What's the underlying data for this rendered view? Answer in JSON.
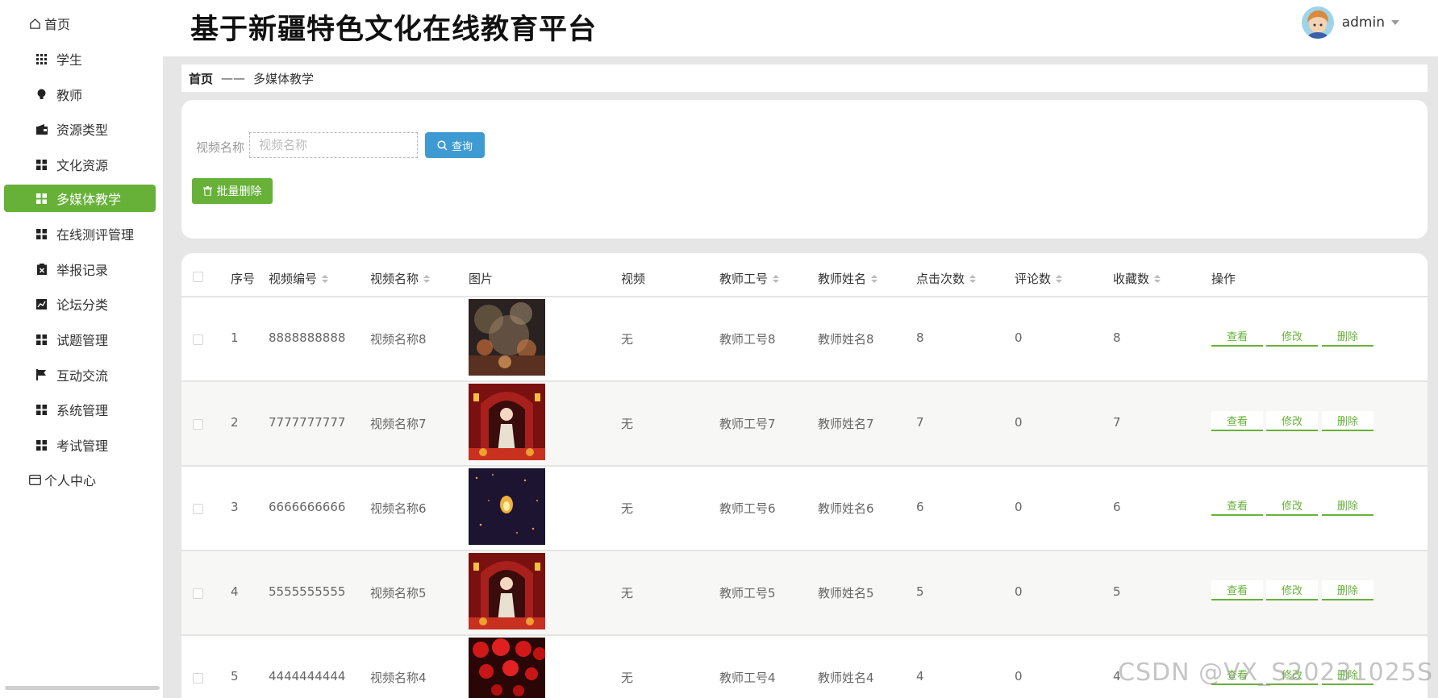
{
  "app": {
    "title": "基于新疆特色文化在线教育平台"
  },
  "user": {
    "name": "admin"
  },
  "sidebar": {
    "items": [
      {
        "label": "首页",
        "icon": "home-icon"
      },
      {
        "label": "学生",
        "icon": "grid-icon"
      },
      {
        "label": "教师",
        "icon": "bulb-icon"
      },
      {
        "label": "资源类型",
        "icon": "wallet-icon"
      },
      {
        "label": "文化资源",
        "icon": "grid-icon"
      },
      {
        "label": "多媒体教学",
        "icon": "grid-icon",
        "active": true
      },
      {
        "label": "在线测评管理",
        "icon": "grid-icon"
      },
      {
        "label": "举报记录",
        "icon": "clipboard-icon"
      },
      {
        "label": "论坛分类",
        "icon": "chart-icon"
      },
      {
        "label": "试题管理",
        "icon": "grid-icon"
      },
      {
        "label": "互动交流",
        "icon": "flag-icon"
      },
      {
        "label": "系统管理",
        "icon": "grid-icon"
      },
      {
        "label": "考试管理",
        "icon": "grid-icon"
      },
      {
        "label": "个人中心",
        "icon": "card-icon"
      }
    ]
  },
  "breadcrumb": {
    "home": "首页",
    "separator": "——",
    "current": "多媒体教学"
  },
  "search": {
    "label": "视频名称",
    "placeholder": "视频名称",
    "query_button": "查询",
    "batch_delete_button": "批量删除"
  },
  "table": {
    "headers": [
      "序号",
      "视频编号",
      "视频名称",
      "图片",
      "视频",
      "教师工号",
      "教师姓名",
      "点击次数",
      "评论数",
      "收藏数",
      "操作"
    ],
    "actions": [
      "查看",
      "修改",
      "删除"
    ],
    "rows": [
      {
        "index": "1",
        "code": "8888888888",
        "name": "视频名称8",
        "image": "fireworks",
        "video": "无",
        "teacher_id": "教师工号8",
        "teacher_name": "教师姓名8",
        "clicks": "8",
        "comments": "0",
        "favorites": "8"
      },
      {
        "index": "2",
        "code": "7777777777",
        "name": "视频名称7",
        "image": "opera-stage",
        "video": "无",
        "teacher_id": "教师工号7",
        "teacher_name": "教师姓名7",
        "clicks": "7",
        "comments": "0",
        "favorites": "7"
      },
      {
        "index": "3",
        "code": "6666666666",
        "name": "视频名称6",
        "image": "sky-lantern",
        "video": "无",
        "teacher_id": "教师工号6",
        "teacher_name": "教师姓名6",
        "clicks": "6",
        "comments": "0",
        "favorites": "6"
      },
      {
        "index": "4",
        "code": "5555555555",
        "name": "视频名称5",
        "image": "opera-stage",
        "video": "无",
        "teacher_id": "教师工号5",
        "teacher_name": "教师姓名5",
        "clicks": "5",
        "comments": "0",
        "favorites": "5"
      },
      {
        "index": "5",
        "code": "4444444444",
        "name": "视频名称4",
        "image": "red-lanterns",
        "video": "无",
        "teacher_id": "教师工号4",
        "teacher_name": "教师姓名4",
        "clicks": "4",
        "comments": "0",
        "favorites": "4"
      }
    ]
  },
  "watermark": "CSDN @VX_S20231025S",
  "colors": {
    "accent": "#67b139",
    "query_button": "#3d9bd1"
  }
}
